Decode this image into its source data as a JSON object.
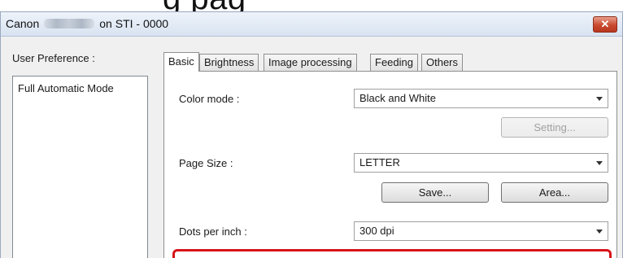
{
  "caption_fragment": "g               pag",
  "window": {
    "title_prefix": "Canon",
    "title_suffix": "on STI - 0000",
    "close_label": "✕"
  },
  "preferences": {
    "label": "User Preference :",
    "items": [
      "Full Automatic Mode"
    ]
  },
  "tabs": [
    {
      "label": "Basic",
      "active": true
    },
    {
      "label": "Brightness",
      "active": false
    },
    {
      "label": "Image processing",
      "active": false
    },
    {
      "label": "Feeding",
      "active": false
    },
    {
      "label": "Others",
      "active": false
    }
  ],
  "basic": {
    "color_mode": {
      "label": "Color mode :",
      "value": "Black and White"
    },
    "setting_button": "Setting...",
    "page_size": {
      "label": "Page Size :",
      "value": "LETTER"
    },
    "save_button": "Save...",
    "area_button": "Area...",
    "dpi": {
      "label": "Dots per inch :",
      "value": "300 dpi"
    }
  },
  "colors": {
    "highlight": "#d7141a",
    "close_button": "#c84a2f"
  }
}
